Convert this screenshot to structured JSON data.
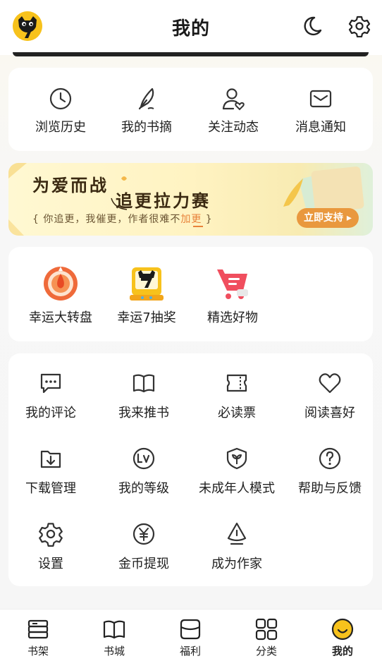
{
  "header": {
    "title": "我的",
    "icons": [
      "avatar-cat-logo",
      "moon-icon",
      "gear-icon"
    ]
  },
  "quick_links": [
    {
      "label": "浏览历史",
      "icon": "clock-icon"
    },
    {
      "label": "我的书摘",
      "icon": "feather-icon"
    },
    {
      "label": "关注动态",
      "icon": "user-heart-icon"
    },
    {
      "label": "消息通知",
      "icon": "mail-icon"
    }
  ],
  "banner": {
    "title1": "为爱而战",
    "title2": "追更拉力赛",
    "sub_pre": "{ 你追更，我催更，作者很难不",
    "sub_hl": "加更",
    "sub_post": " }",
    "button": "立即支持 ▸"
  },
  "activities": [
    {
      "label": "幸运大转盘",
      "icon": "lucky-wheel-icon"
    },
    {
      "label": "幸运7抽奖",
      "icon": "lucky7-icon"
    },
    {
      "label": "精选好物",
      "icon": "cart-icon"
    }
  ],
  "services": [
    {
      "label": "我的评论",
      "icon": "comment-icon"
    },
    {
      "label": "我来推书",
      "icon": "book-open-icon"
    },
    {
      "label": "必读票",
      "icon": "ticket-icon"
    },
    {
      "label": "阅读喜好",
      "icon": "heart-icon"
    },
    {
      "label": "下载管理",
      "icon": "download-folder-icon"
    },
    {
      "label": "我的等级",
      "icon": "level-icon"
    },
    {
      "label": "未成年人模式",
      "icon": "shield-sprout-icon"
    },
    {
      "label": "帮助与反馈",
      "icon": "help-icon"
    },
    {
      "label": "设置",
      "icon": "settings-icon"
    },
    {
      "label": "金币提现",
      "icon": "coin-icon"
    },
    {
      "label": "成为作家",
      "icon": "pen-nib-icon"
    }
  ],
  "bottom_nav": [
    {
      "label": "书架",
      "icon": "bookshelf-icon"
    },
    {
      "label": "书城",
      "icon": "bookstore-icon"
    },
    {
      "label": "福利",
      "icon": "gift-box-icon"
    },
    {
      "label": "分类",
      "icon": "grid-icon"
    },
    {
      "label": "我的",
      "icon": "smile-icon",
      "active": true
    }
  ],
  "colors": {
    "accent": "#f7c21c",
    "banner_button": "#e9983e",
    "cart": "#f04e5e",
    "wheel": "#ef6a3a"
  }
}
